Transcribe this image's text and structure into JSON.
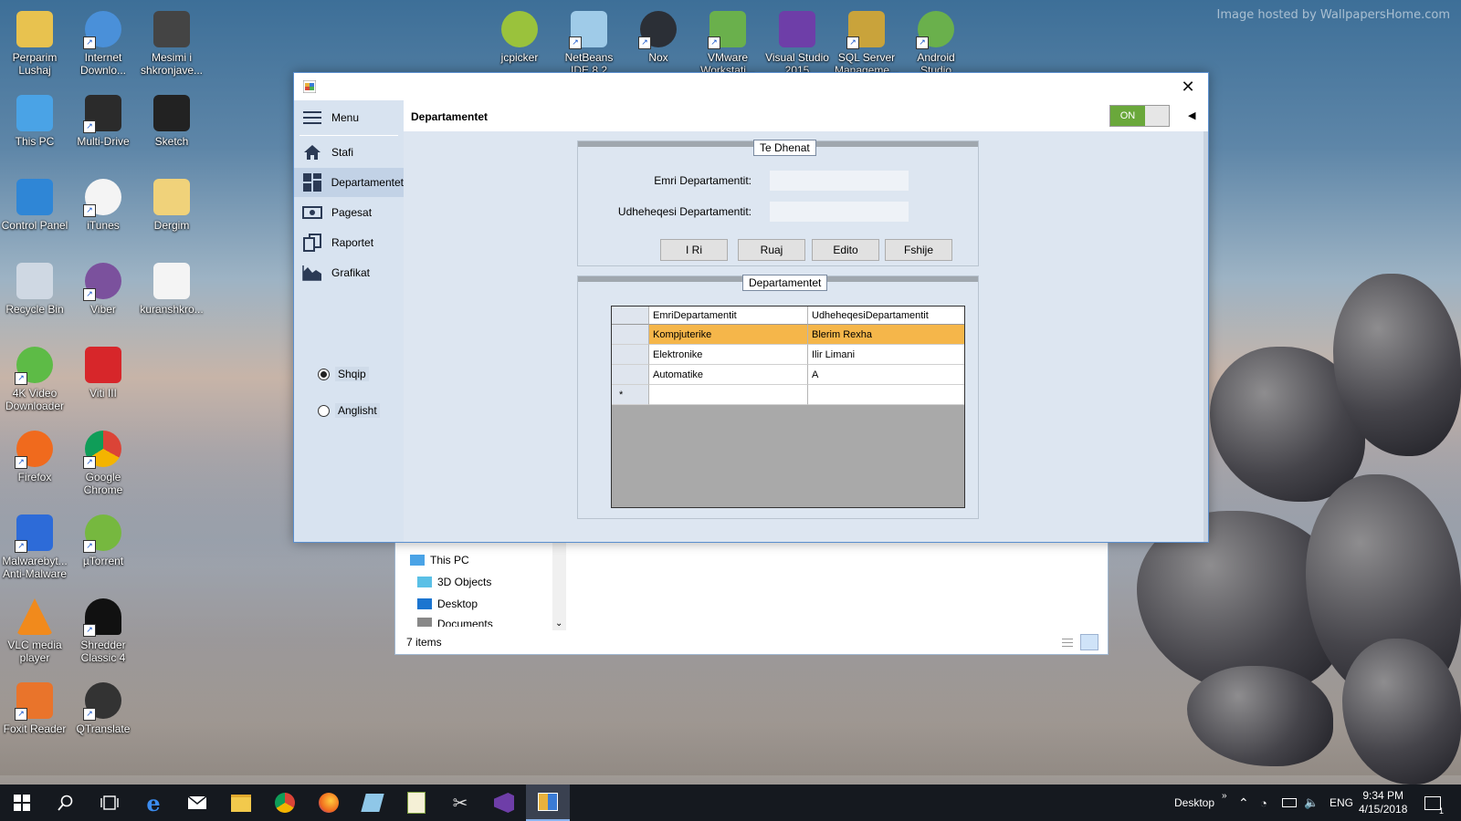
{
  "watermark": "Image hosted by WallpapersHome.com",
  "desktop_icons": [
    {
      "name": "perparim-lushaj-icon",
      "label": "Perparim Lushaj",
      "color": "#e8c24f"
    },
    {
      "name": "internet-download-manager-icon",
      "label": "Internet Downlo...",
      "color": "#4a90d9"
    },
    {
      "name": "mesimi-shkronjave-icon",
      "label": "Mesimi i shkronjave...",
      "color": "#444"
    },
    {
      "name": "this-pc-icon",
      "label": "This PC",
      "color": "#4aa3e6"
    },
    {
      "name": "multi-drive-icon",
      "label": "Multi-Drive",
      "color": "#2b2b2b"
    },
    {
      "name": "sketch-icon",
      "label": "Sketch",
      "color": "#222"
    },
    {
      "name": "control-panel-icon",
      "label": "Control Panel",
      "color": "#2f86d6"
    },
    {
      "name": "itunes-icon",
      "label": "iTunes",
      "color": "#f4f4f4"
    },
    {
      "name": "dergim-folder-icon",
      "label": "Dergim",
      "color": "#f0d27a"
    },
    {
      "name": "recycle-bin-icon",
      "label": "Recycle Bin",
      "color": "#cfd8e3"
    },
    {
      "name": "viber-icon",
      "label": "Viber",
      "color": "#7b519d"
    },
    {
      "name": "kuranshkro-file-icon",
      "label": "kuranshkro...",
      "color": "#f4f4f4"
    },
    {
      "name": "4k-video-downloader-icon",
      "label": "4K Video Downloader",
      "color": "#5dbb46"
    },
    {
      "name": "viti-iii-folder-icon",
      "label": "Viti III",
      "color": "#d7262a"
    },
    {
      "name": "firefox-icon",
      "label": "Firefox",
      "color": "#f06a1d"
    },
    {
      "name": "google-chrome-icon",
      "label": "Google Chrome",
      "color": "#2f9a44"
    },
    {
      "name": "malwarebytes-icon",
      "label": "Malwarebyt... Anti-Malware",
      "color": "#2d6bd8"
    },
    {
      "name": "utorrent-icon",
      "label": "µTorrent",
      "color": "#76b83f"
    },
    {
      "name": "vlc-media-player-icon",
      "label": "VLC media player",
      "color": "#f18a1c"
    },
    {
      "name": "shredder-classic-icon",
      "label": "Shredder Classic 4",
      "color": "#111"
    },
    {
      "name": "foxit-reader-icon",
      "label": "Foxit Reader",
      "color": "#e9742b"
    },
    {
      "name": "qtranslate-icon",
      "label": "QTranslate",
      "color": "#333"
    },
    {
      "name": "jcpicker-icon",
      "label": "jcpicker",
      "color": "#9ac23c"
    },
    {
      "name": "netbeans-ide-icon",
      "label": "NetBeans IDE 8.2",
      "color": "#9fcbe8"
    },
    {
      "name": "nox-icon",
      "label": "Nox",
      "color": "#2b2f36"
    },
    {
      "name": "vmware-workstation-icon",
      "label": "VMware Workstati...",
      "color": "#6ab04c"
    },
    {
      "name": "visual-studio-2015-icon",
      "label": "Visual Studio 2015",
      "color": "#6e3ea8"
    },
    {
      "name": "sql-server-management-icon",
      "label": "SQL Server Manageme...",
      "color": "#c9a33b"
    },
    {
      "name": "android-studio-icon",
      "label": "Android Studio",
      "color": "#6ab04c"
    }
  ],
  "explorer": {
    "tree": [
      "This PC",
      "3D Objects",
      "Desktop",
      "Documents"
    ],
    "status": "7 items"
  },
  "app": {
    "nav": {
      "menu_label": "Menu",
      "items": [
        "Stafi",
        "Departamentet",
        "Pagesat",
        "Raportet",
        "Grafikat"
      ]
    },
    "languages": {
      "shqip": "Shqip",
      "anglisht": "Anglisht",
      "selected": "Shqip"
    },
    "header_title": "Departamentet",
    "toggle_label": "ON",
    "form": {
      "caption": "Te Dhenat",
      "emri_label": "Emri Departamentit:",
      "emri_value": "",
      "udheheqesi_label": "Udheheqesi Departamentit:",
      "udheheqesi_value": "",
      "buttons": {
        "new": "I Ri",
        "save": "Ruaj",
        "edit": "Edito",
        "delete": "Fshije"
      }
    },
    "grid": {
      "caption": "Departamentet",
      "columns": [
        "EmriDepartamentit",
        "UdheheqesiDepartamentit"
      ],
      "rows": [
        [
          "Kompjuterike",
          "Blerim Rexha"
        ],
        [
          "Elektronike",
          "Ilir Limani"
        ],
        [
          "Automatike",
          "A"
        ]
      ],
      "new_row_marker": "*",
      "selected_row": 0
    }
  },
  "taskbar": {
    "desktop_label": "Desktop",
    "language": "ENG",
    "time": "9:34 PM",
    "date": "4/15/2018",
    "notification_count": "1"
  }
}
